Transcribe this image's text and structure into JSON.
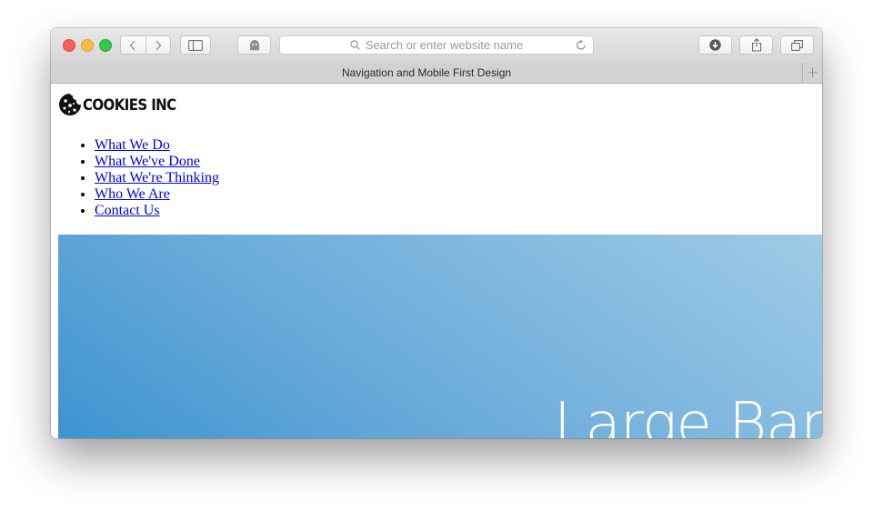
{
  "browser": {
    "address_placeholder": "Search or enter website name",
    "tab_title": "Navigation and Mobile First Design",
    "new_tab_label": "+",
    "icons": {
      "back": "chevron-left-icon",
      "forward": "chevron-right-icon",
      "sidebar": "sidebar-icon",
      "privacy": "ghost-icon",
      "search": "magnifier-icon",
      "reload": "reload-icon",
      "downloads": "download-icon",
      "share": "share-icon",
      "tabs": "tabs-icon"
    }
  },
  "page": {
    "logo_text": "COOKIES INC",
    "nav_items": [
      "What We Do",
      "What We've Done",
      "What We're Thinking",
      "Who We Are",
      "Contact Us"
    ],
    "banner_title": "Large Banner",
    "banner_gradient": [
      "#3e93d1",
      "#9fcbe6"
    ],
    "link_color": "#0000ee"
  }
}
